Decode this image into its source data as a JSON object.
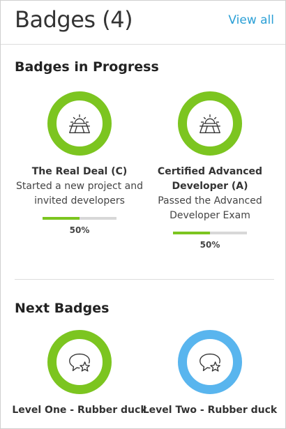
{
  "header": {
    "title": "Badges (4)",
    "view_all": "View all"
  },
  "in_progress": {
    "title": "Badges in Progress",
    "badges": [
      {
        "name": "The Real Deal (C)",
        "description": "Started a new project and invited developers",
        "progress": 0.5,
        "progress_label": "50%",
        "ring_color": "#7cc520",
        "icon": "landscape-sun-icon"
      },
      {
        "name": "Certified Advanced Developer (A)",
        "description": "Passed the Advanced Developer Exam",
        "progress": 0.5,
        "progress_label": "50%",
        "ring_color": "#7cc520",
        "icon": "landscape-sun-icon"
      }
    ]
  },
  "next": {
    "title": "Next Badges",
    "badges": [
      {
        "name": "Level One - Rubber duck",
        "ring_color": "#7cc520",
        "icon": "chat-star-icon"
      },
      {
        "name": "Level Two - Rubber duck",
        "ring_color": "#59b5ee",
        "icon": "chat-star-icon"
      }
    ]
  }
}
